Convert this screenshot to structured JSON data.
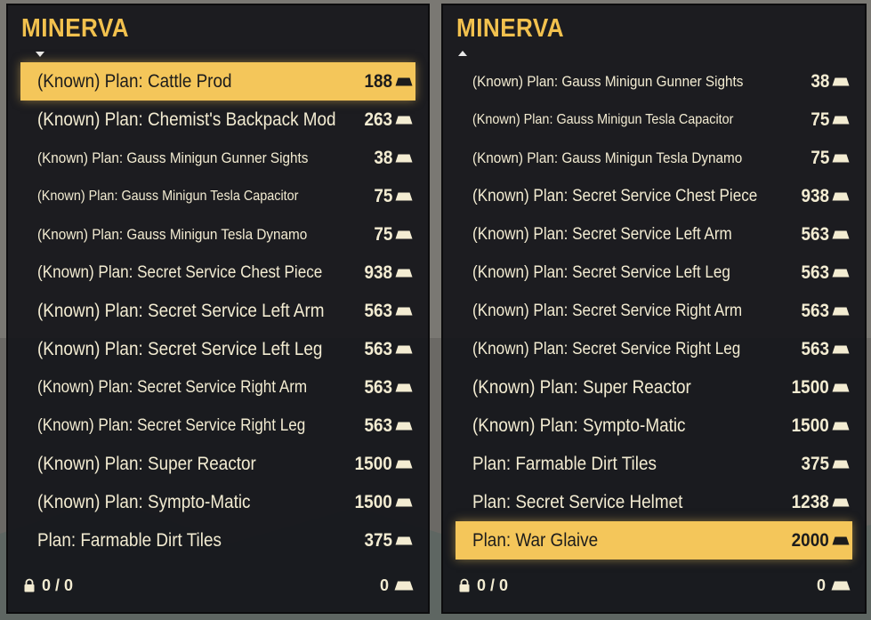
{
  "left_panel": {
    "title": "MINERVA",
    "items": [
      {
        "name": "(Known)  Plan: Cattle Prod",
        "price": "188",
        "selected": true,
        "size": "l"
      },
      {
        "name": "(Known)  Plan: Chemist's Backpack Mod",
        "price": "263",
        "selected": false,
        "size": "l"
      },
      {
        "name": "(Known)  Plan: Gauss Minigun Gunner Sights",
        "price": "38",
        "selected": false,
        "size": "s"
      },
      {
        "name": "(Known)  Plan: Gauss Minigun Tesla Capacitor",
        "price": "75",
        "selected": false,
        "size": "xs"
      },
      {
        "name": "(Known)  Plan: Gauss Minigun Tesla Dynamo",
        "price": "75",
        "selected": false,
        "size": "s"
      },
      {
        "name": "(Known)  Plan: Secret Service Chest Piece",
        "price": "938",
        "selected": false,
        "size": "m"
      },
      {
        "name": "(Known)  Plan: Secret Service Left Arm",
        "price": "563",
        "selected": false,
        "size": "l"
      },
      {
        "name": "(Known)  Plan: Secret Service Left Leg",
        "price": "563",
        "selected": false,
        "size": "l"
      },
      {
        "name": "(Known)  Plan: Secret Service Right Arm",
        "price": "563",
        "selected": false,
        "size": "m"
      },
      {
        "name": "(Known)  Plan: Secret Service Right Leg",
        "price": "563",
        "selected": false,
        "size": "m"
      },
      {
        "name": "(Known)  Plan: Super Reactor",
        "price": "1500",
        "selected": false,
        "size": "l"
      },
      {
        "name": "(Known)  Plan: Sympto-Matic",
        "price": "1500",
        "selected": false,
        "size": "l"
      },
      {
        "name": "Plan: Farmable Dirt Tiles",
        "price": "375",
        "selected": false,
        "size": "l"
      }
    ],
    "footer": {
      "weight": "0 / 0",
      "caps": "0"
    }
  },
  "right_panel": {
    "title": "MINERVA",
    "items": [
      {
        "name": "(Known)  Plan: Gauss Minigun Gunner Sights",
        "price": "38",
        "selected": false,
        "size": "s"
      },
      {
        "name": "(Known)  Plan: Gauss Minigun Tesla Capacitor",
        "price": "75",
        "selected": false,
        "size": "xs"
      },
      {
        "name": "(Known)  Plan: Gauss Minigun Tesla Dynamo",
        "price": "75",
        "selected": false,
        "size": "s"
      },
      {
        "name": "(Known)  Plan: Secret Service Chest Piece",
        "price": "938",
        "selected": false,
        "size": "m"
      },
      {
        "name": "(Known)  Plan: Secret Service Left Arm",
        "price": "563",
        "selected": false,
        "size": "m"
      },
      {
        "name": "(Known)  Plan: Secret Service Left Leg",
        "price": "563",
        "selected": false,
        "size": "m"
      },
      {
        "name": "(Known)  Plan: Secret Service Right Arm",
        "price": "563",
        "selected": false,
        "size": "m"
      },
      {
        "name": "(Known)  Plan: Secret Service Right Leg",
        "price": "563",
        "selected": false,
        "size": "m"
      },
      {
        "name": "(Known)  Plan: Super Reactor",
        "price": "1500",
        "selected": false,
        "size": "l"
      },
      {
        "name": "(Known)  Plan: Sympto-Matic",
        "price": "1500",
        "selected": false,
        "size": "l"
      },
      {
        "name": "Plan: Farmable Dirt Tiles",
        "price": "375",
        "selected": false,
        "size": "l"
      },
      {
        "name": "Plan: Secret Service Helmet",
        "price": "1238",
        "selected": false,
        "size": "l"
      },
      {
        "name": "Plan: War Glaive",
        "price": "2000",
        "selected": true,
        "size": "l"
      }
    ],
    "footer": {
      "weight": "0 / 0",
      "caps": "0"
    }
  },
  "colors": {
    "accent": "#f2c14e",
    "selected_bg": "#f4c65a",
    "text": "#f3ecd2",
    "panel_bg": "#16181c"
  },
  "icons": {
    "currency": "caps-icon",
    "weight": "lock-icon"
  }
}
